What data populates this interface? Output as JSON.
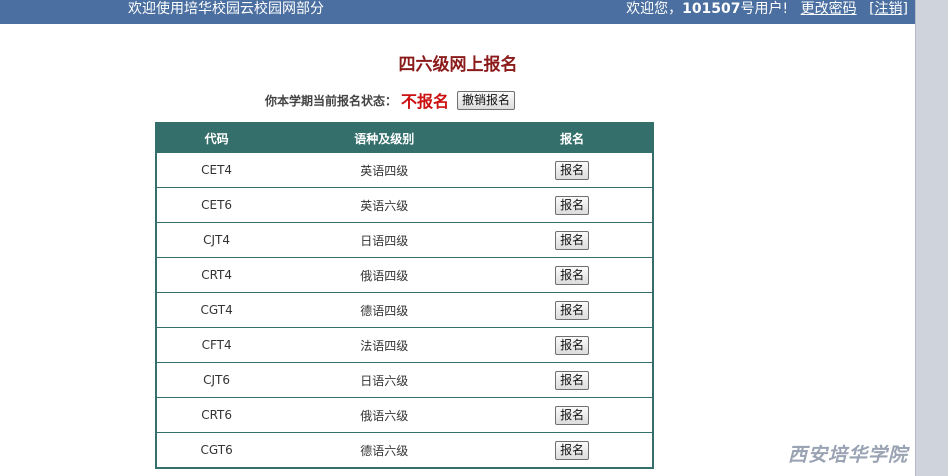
{
  "topbar": {
    "site_welcome": "欢迎使用培华校园云校园网部分",
    "user_prefix": "欢迎您，",
    "user_id": "101507",
    "user_suffix": "号用户!",
    "change_password": "更改密码",
    "logout_open": "[",
    "logout": "注销",
    "logout_close": "]"
  },
  "page": {
    "title": "四六级网上报名",
    "status_label": "你本学期当前报名状态：",
    "status_value": "不报名",
    "cancel_button": "撤销报名"
  },
  "table": {
    "headers": [
      "代码",
      "语种及级别",
      "报名"
    ],
    "rows": [
      {
        "code": "CET4",
        "name": "英语四级",
        "action": "报名"
      },
      {
        "code": "CET6",
        "name": "英语六级",
        "action": "报名"
      },
      {
        "code": "CJT4",
        "name": "日语四级",
        "action": "报名"
      },
      {
        "code": "CRT4",
        "name": "俄语四级",
        "action": "报名"
      },
      {
        "code": "CGT4",
        "name": "德语四级",
        "action": "报名"
      },
      {
        "code": "CFT4",
        "name": "法语四级",
        "action": "报名"
      },
      {
        "code": "CJT6",
        "name": "日语六级",
        "action": "报名"
      },
      {
        "code": "CRT6",
        "name": "俄语六级",
        "action": "报名"
      },
      {
        "code": "CGT6",
        "name": "德语六级",
        "action": "报名"
      }
    ]
  },
  "watermark": "西安培华学院",
  "colors": {
    "topbar": "#4a6fa0",
    "table_header": "#356f6b",
    "title": "#8b1a1a",
    "status": "#cc1010"
  }
}
